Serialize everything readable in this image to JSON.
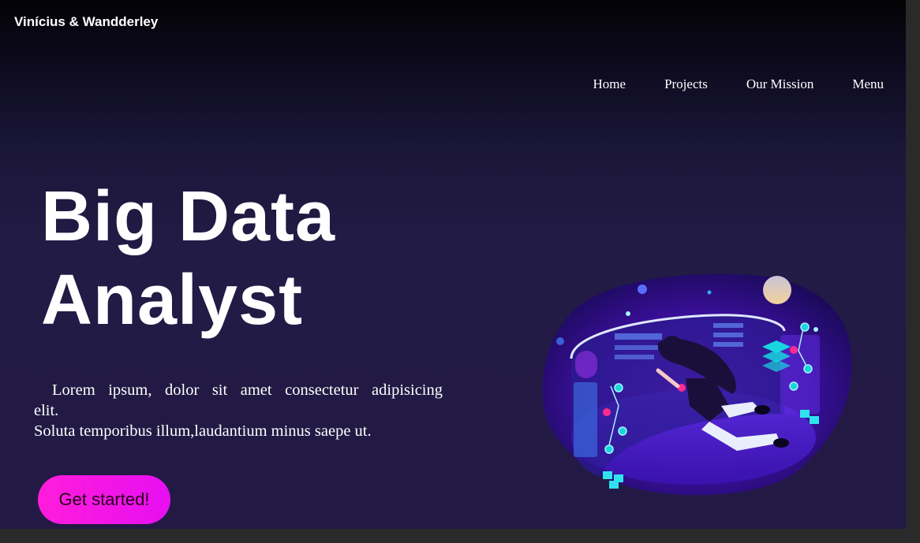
{
  "brand": {
    "name": "Vinícius & Wandderley"
  },
  "nav": {
    "items": [
      {
        "label": "Home"
      },
      {
        "label": "Projects"
      },
      {
        "label": "Our Mission"
      },
      {
        "label": "Menu"
      }
    ]
  },
  "hero": {
    "title_line1": "Big Data",
    "title_line2": "Analyst",
    "desc_line1": "Lorem ipsum, dolor sit amet consectetur adipisicing",
    "desc_line2": "elit.",
    "desc_line3": "Soluta temporibus illum,laudantium minus saepe ut.",
    "cta_label": "Get started!"
  },
  "colors": {
    "background_top": "#030305",
    "background_main": "#221b45",
    "cta_gradient_start": "#ff1ddb",
    "cta_gradient_end": "#e60ff0",
    "text": "#ffffff"
  },
  "illustration": {
    "icon": "big-data-woman-floating-illustration"
  }
}
